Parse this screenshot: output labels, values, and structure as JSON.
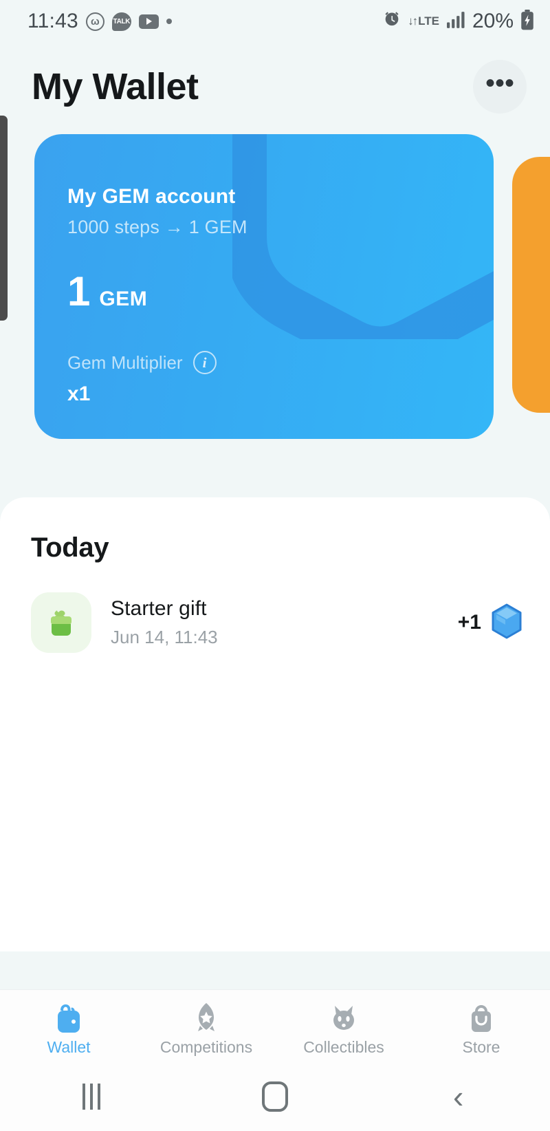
{
  "status_bar": {
    "time": "11:43",
    "left_icons": [
      "circle-w-icon",
      "kakao-talk-icon",
      "youtube-icon",
      "dot-icon"
    ],
    "talk_label": "TALK",
    "alarm_icon": "alarm-icon",
    "network_type": "LTE",
    "network_arrows": "↓↑",
    "signal_icon": "signal-bars-icon",
    "battery_percent": "20%",
    "battery_icon": "battery-charging-icon"
  },
  "header": {
    "title": "My Wallet",
    "more_label": "•••"
  },
  "gem_card": {
    "title": "My GEM account",
    "subtitle": "1000 steps → 1 GEM",
    "balance": "1",
    "balance_unit": "GEM",
    "multiplier_label": "Gem Multiplier",
    "info_label": "i",
    "multiplier_value": "x1",
    "color_start": "#3aa2ef",
    "color_end": "#34b6f7",
    "next_card_color": "#f4a02e"
  },
  "today": {
    "heading": "Today",
    "transactions": [
      {
        "icon": "gift-icon",
        "name": "Starter gift",
        "date": "Jun 14, 11:43",
        "amount": "+1",
        "currency_icon": "gem-icon"
      }
    ]
  },
  "bottom_nav": {
    "active_color": "#4eaef0",
    "items": [
      {
        "label": "Wallet",
        "icon": "wallet-icon",
        "active": true
      },
      {
        "label": "Competitions",
        "icon": "rocket-star-icon",
        "active": false
      },
      {
        "label": "Collectibles",
        "icon": "cat-face-icon",
        "active": false
      },
      {
        "label": "Store",
        "icon": "shopping-bag-icon",
        "active": false
      }
    ]
  },
  "android_nav": {
    "recents": "recents-icon",
    "home": "home-icon",
    "back": "‹"
  }
}
